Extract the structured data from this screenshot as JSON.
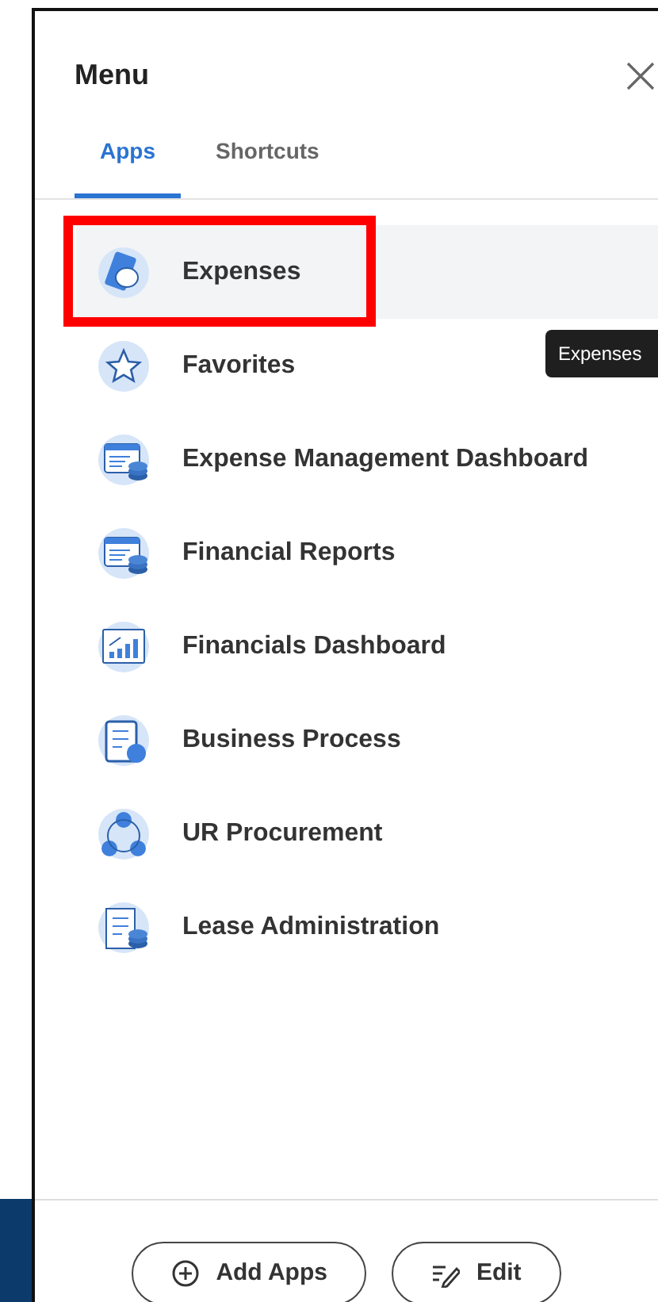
{
  "menu": {
    "title": "Menu"
  },
  "tabs": [
    {
      "label": "Apps",
      "selected": true
    },
    {
      "label": "Shortcuts",
      "selected": false
    }
  ],
  "apps": [
    {
      "label": "Expenses",
      "selected": true,
      "annotated": true
    },
    {
      "label": "Favorites",
      "selected": false,
      "annotated": false
    },
    {
      "label": "Expense Management Dashboard",
      "selected": false,
      "annotated": false
    },
    {
      "label": "Financial Reports",
      "selected": false,
      "annotated": false
    },
    {
      "label": "Financials Dashboard",
      "selected": false,
      "annotated": false
    },
    {
      "label": "Business Process",
      "selected": false,
      "annotated": false
    },
    {
      "label": "UR Procurement",
      "selected": false,
      "annotated": false
    },
    {
      "label": "Lease Administration",
      "selected": false,
      "annotated": false
    }
  ],
  "tooltip": "Expenses",
  "buttons": [
    {
      "label": "Add Apps",
      "kind": "add"
    },
    {
      "label": "Edit",
      "kind": "edit"
    }
  ]
}
